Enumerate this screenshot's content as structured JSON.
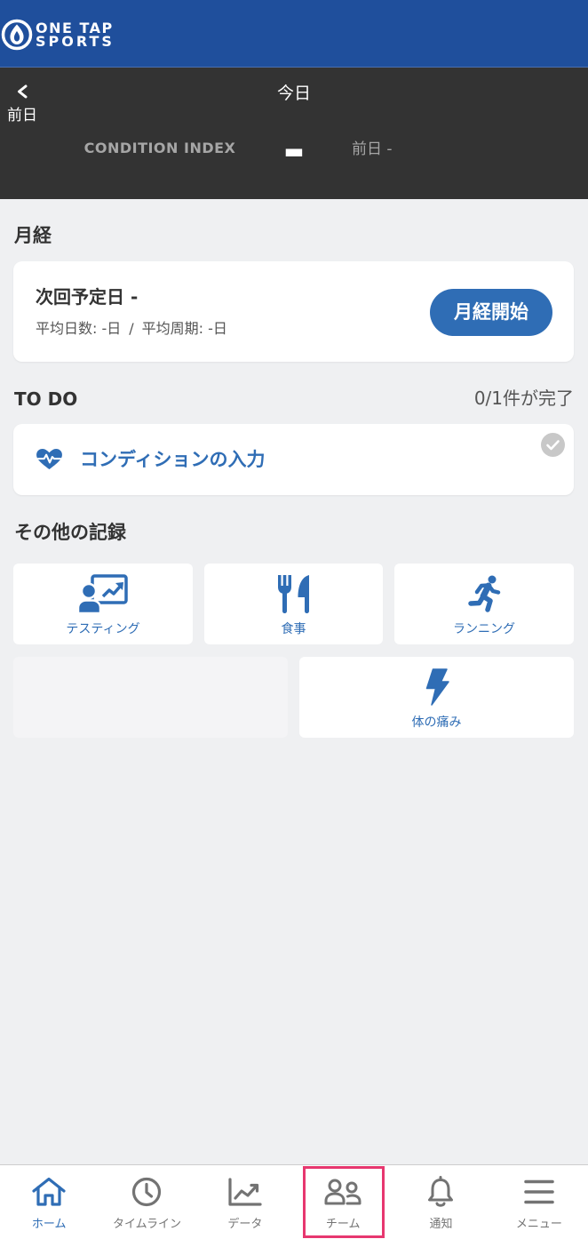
{
  "header": {
    "logo_line1": "ONE TAP",
    "logo_line2": "SPORTS",
    "logo_icon": "flame-circle-icon"
  },
  "nav": {
    "back_icon": "chevron-left-icon",
    "back_label": "前日",
    "title": "今日"
  },
  "condition": {
    "label": "CONDITION INDEX",
    "value": "-",
    "previous": "前日 -"
  },
  "menstruation": {
    "heading": "月経",
    "next_date": "次回予定日 -",
    "avg_days": "平均日数: -日",
    "separator": "/",
    "avg_cycle": "平均周期: -日",
    "start_button": "月経開始"
  },
  "todo": {
    "heading": "TO DO",
    "progress": "0/1件が完了",
    "items": [
      {
        "label": "コンディションの入力",
        "icon": "heart-pulse-icon",
        "completed": false
      }
    ]
  },
  "other_records": {
    "heading": "その他の記録",
    "tiles": [
      {
        "label": "テスティング",
        "icon": "presentation-icon"
      },
      {
        "label": "食事",
        "icon": "utensils-icon"
      },
      {
        "label": "ランニング",
        "icon": "running-icon"
      },
      {
        "label": "体の痛み",
        "icon": "lightning-icon"
      }
    ]
  },
  "tab_bar": {
    "tabs": [
      {
        "label": "ホーム",
        "icon": "home-icon",
        "active": true,
        "highlighted": false
      },
      {
        "label": "タイムライン",
        "icon": "clock-icon",
        "active": false,
        "highlighted": false
      },
      {
        "label": "データ",
        "icon": "chart-icon",
        "active": false,
        "highlighted": false
      },
      {
        "label": "チーム",
        "icon": "team-icon",
        "active": false,
        "highlighted": true
      },
      {
        "label": "通知",
        "icon": "bell-icon",
        "active": false,
        "highlighted": false
      },
      {
        "label": "メニュー",
        "icon": "menu-icon",
        "active": false,
        "highlighted": false
      }
    ]
  },
  "colors": {
    "header_bg": "#1f4f9c",
    "panel_bg": "#333333",
    "page_bg": "#eff0f2",
    "accent": "#2f6db5",
    "highlight": "#e7376f",
    "muted_text": "#a6a6a6",
    "body_text": "#333333",
    "secondary_text": "#555555",
    "tab_inactive": "#737373"
  }
}
